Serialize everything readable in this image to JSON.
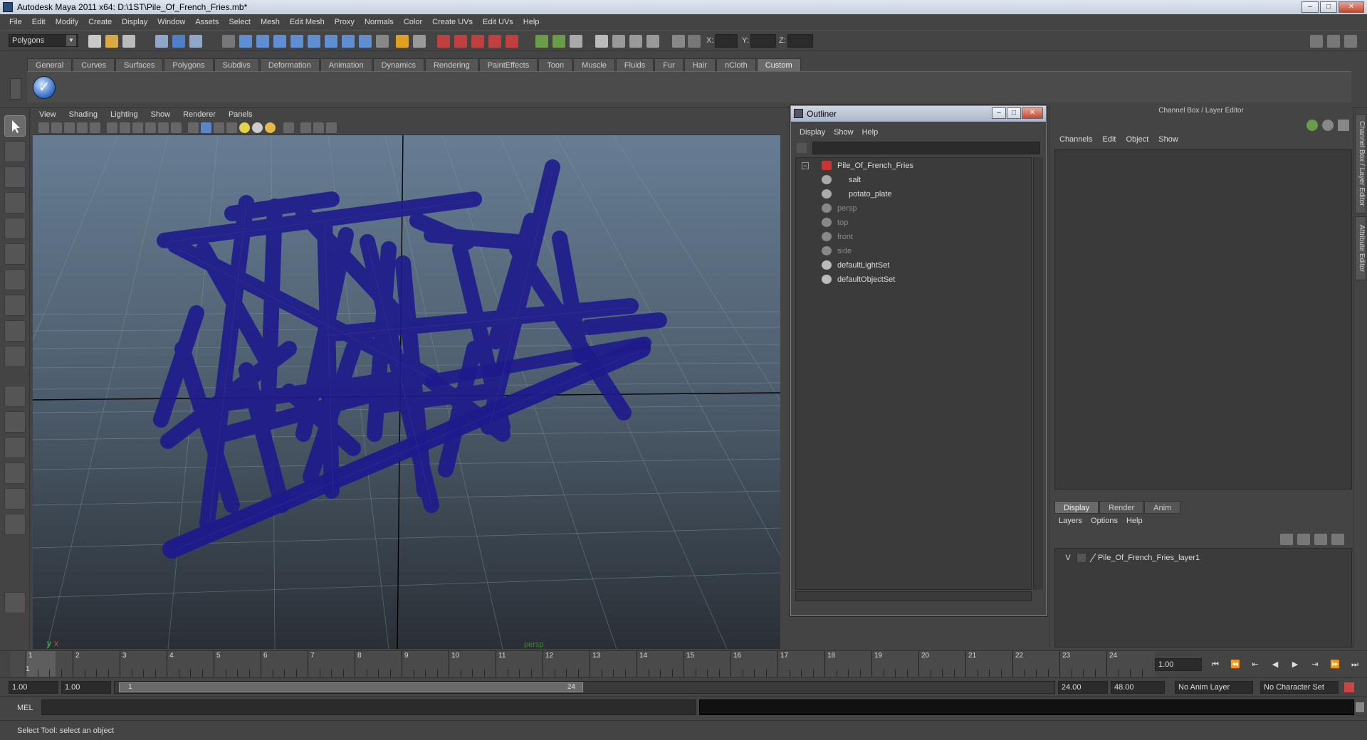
{
  "window": {
    "title": "Autodesk Maya 2011 x64: D:\\1ST\\Pile_Of_French_Fries.mb*",
    "buttons": [
      "–",
      "□",
      "✕"
    ]
  },
  "menubar": [
    "File",
    "Edit",
    "Modify",
    "Create",
    "Display",
    "Window",
    "Assets",
    "Select",
    "Mesh",
    "Edit Mesh",
    "Proxy",
    "Normals",
    "Color",
    "Create UVs",
    "Edit UVs",
    "Help"
  ],
  "statusline": {
    "mode": "Polygons",
    "labels": {
      "x": "X:",
      "y": "Y:",
      "z": "Z:"
    }
  },
  "shelf": {
    "tabs": [
      "General",
      "Curves",
      "Surfaces",
      "Polygons",
      "Subdivs",
      "Deformation",
      "Animation",
      "Dynamics",
      "Rendering",
      "PaintEffects",
      "Toon",
      "Muscle",
      "Fluids",
      "Fur",
      "Hair",
      "nCloth",
      "Custom"
    ],
    "active": "Custom"
  },
  "viewport": {
    "menu": [
      "View",
      "Shading",
      "Lighting",
      "Show",
      "Renderer",
      "Panels"
    ],
    "camera_label": "persp",
    "axis": {
      "y": "y",
      "x": "x"
    },
    "wire_color": "#1e1a8c"
  },
  "outliner": {
    "title": "Outliner",
    "menu": [
      "Display",
      "Show",
      "Help"
    ],
    "items": [
      {
        "label": "Pile_Of_French_Fries",
        "dim": false
      },
      {
        "label": "salt",
        "dim": false
      },
      {
        "label": "potato_plate",
        "dim": false
      },
      {
        "label": "persp",
        "dim": true
      },
      {
        "label": "top",
        "dim": true
      },
      {
        "label": "front",
        "dim": true
      },
      {
        "label": "side",
        "dim": true
      },
      {
        "label": "defaultLightSet",
        "dim": false
      },
      {
        "label": "defaultObjectSet",
        "dim": false
      }
    ]
  },
  "channelbox": {
    "title": "Channel Box / Layer Editor",
    "menu": [
      "Channels",
      "Edit",
      "Object",
      "Show"
    ],
    "layer_tabs": [
      "Display",
      "Render",
      "Anim"
    ],
    "layer_menu": [
      "Layers",
      "Options",
      "Help"
    ],
    "layer": {
      "visible": "V",
      "name": "Pile_Of_French_Fries_layer1"
    }
  },
  "side_tabs": [
    "Channel Box / Layer Editor",
    "Attribute Editor"
  ],
  "timeline": {
    "ticks": [
      "1",
      "2",
      "3",
      "4",
      "5",
      "6",
      "7",
      "8",
      "9",
      "10",
      "11",
      "12",
      "13",
      "14",
      "15",
      "16",
      "17",
      "18",
      "19",
      "20",
      "21",
      "22",
      "23",
      "24"
    ],
    "first_label": "1",
    "current_frame": "1.00",
    "playback": [
      "⏮",
      "⏪",
      "⇤",
      "◀",
      "▶",
      "⇥",
      "⏩",
      "⏭"
    ]
  },
  "range": {
    "start": "1.00",
    "playback_start": "1.00",
    "handle_start": "1",
    "handle_end": "24",
    "playback_end": "24.00",
    "end": "48.00",
    "anim_layer": "No Anim Layer",
    "character_set": "No Character Set"
  },
  "mel": {
    "label": "MEL"
  },
  "help_line": "Select Tool: select an object"
}
